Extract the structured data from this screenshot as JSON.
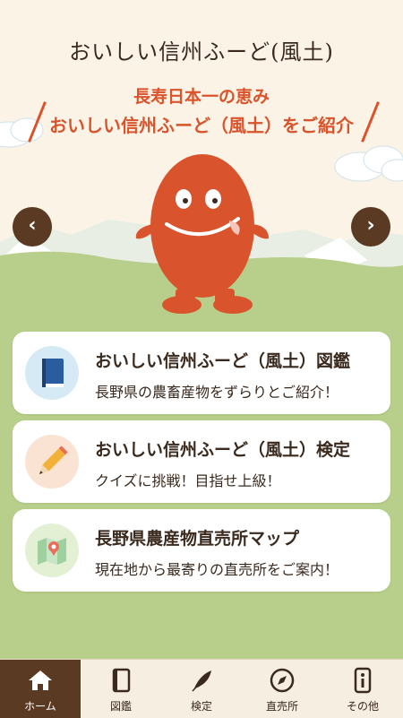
{
  "header": {
    "logo_text": "おいしい信州ふーど(風土)"
  },
  "hero": {
    "line1": "長寿日本一の恵み",
    "line2": "おいしい信州ふーど（風土）をご紹介",
    "prev_icon": "chevron-left-icon",
    "next_icon": "chevron-right-icon",
    "prev_glyph": "‹",
    "next_glyph": "›"
  },
  "menu": {
    "items": [
      {
        "title": "おいしい信州ふーど（風土）図鑑",
        "description": "長野県の農畜産物をずらりとご紹介！",
        "icon": "book-icon",
        "icon_bg": "#d6eaf5"
      },
      {
        "title": "おいしい信州ふーど（風土）検定",
        "description": "クイズに挑戦！目指せ上級！",
        "icon": "pencil-icon",
        "icon_bg": "#fbe3d3"
      },
      {
        "title": "長野県農産物直売所マップ",
        "description": "現在地から最寄りの直売所をご案内！",
        "icon": "map-icon",
        "icon_bg": "#e4f0d4"
      }
    ]
  },
  "tabbar": {
    "tabs": [
      {
        "label": "ホーム",
        "icon": "home-icon",
        "active": true
      },
      {
        "label": "図鑑",
        "icon": "book-icon",
        "active": false
      },
      {
        "label": "検定",
        "icon": "quill-icon",
        "active": false
      },
      {
        "label": "直売所",
        "icon": "compass-icon",
        "active": false
      },
      {
        "label": "その他",
        "icon": "info-icon",
        "active": false
      }
    ]
  },
  "colors": {
    "accent": "#d9542c",
    "brown": "#5b3a23",
    "grass": "#b7cf8a",
    "mountain": "#e8eee4",
    "sky": "#fbf4e6"
  }
}
